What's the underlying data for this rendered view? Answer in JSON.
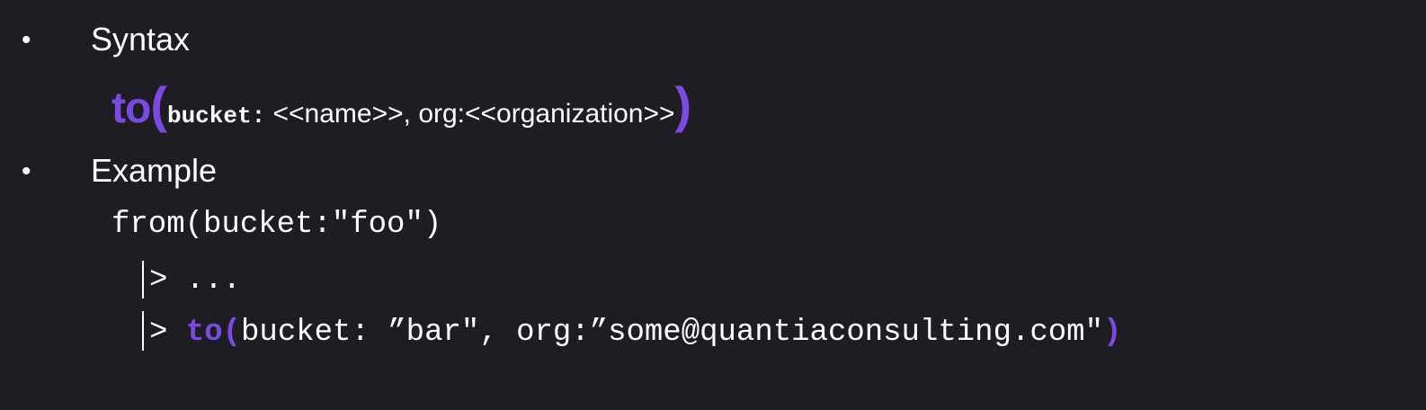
{
  "bullets": [
    {
      "marker": "•",
      "label": "Syntax"
    },
    {
      "marker": "•",
      "label": "Example"
    }
  ],
  "syntax": {
    "keyword": "to",
    "open_paren": "(",
    "param_mono": "bucket:",
    "param_rest": " <<name>>, org:<<organization>>",
    "close_paren": ")"
  },
  "example": {
    "line1": "from(bucket:\"foo\")",
    "line2_pipe": ">",
    "line2_rest": " ...",
    "line3_pipe": ">",
    "line3_keyword": "to",
    "line3_open": "(",
    "line3_args": "bucket: ”bar\", org:”some@quantiaconsulting.com\"",
    "line3_close": ")"
  },
  "colors": {
    "background": "#1e1d23",
    "accent": "#7b4ae2",
    "text": "#ffffff"
  }
}
